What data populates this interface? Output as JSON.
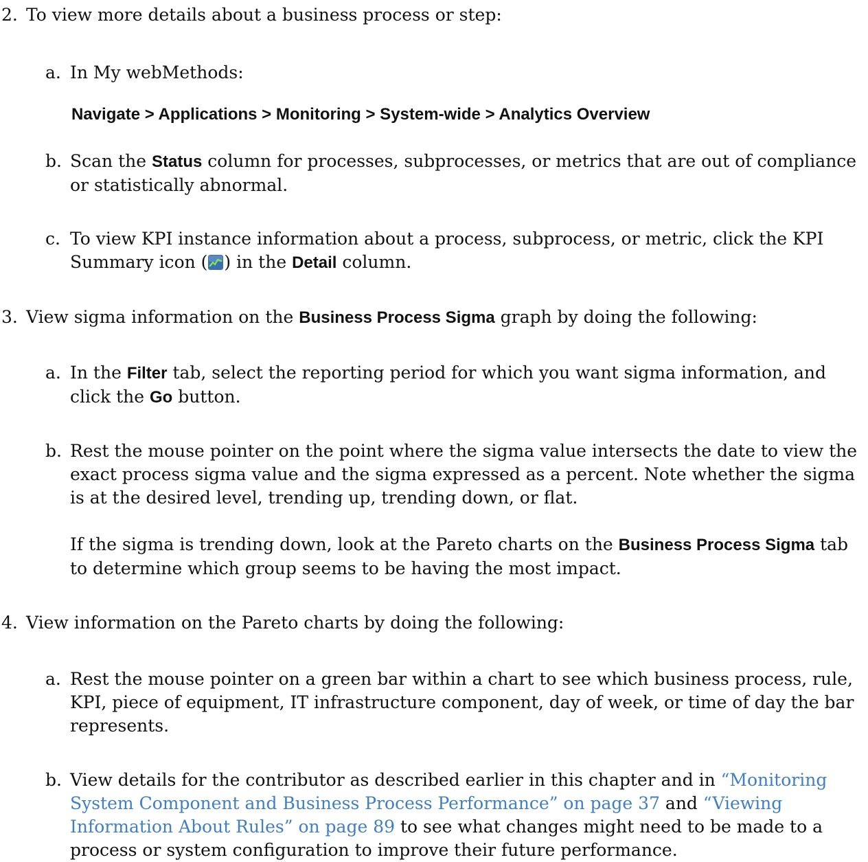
{
  "step2": {
    "num": "2.",
    "text": "To view more details about a business process or step:",
    "a": {
      "letter": "a.",
      "text": "In My webMethods:",
      "nav": "Navigate > Applications > Monitoring > System-wide > Analytics Overview"
    },
    "b": {
      "letter": "b.",
      "t1": "Scan the ",
      "bold": "Status",
      "t2": " column for processes, subprocesses, or metrics that are out of compliance or statistically abnormal."
    },
    "c": {
      "letter": "c.",
      "t1": "To view KPI instance information about a process, subprocess, or metric, click the KPI Summary icon (",
      "t2": ") in the ",
      "bold": "Detail",
      "t3": " column.",
      "icon": "kpi-summary-icon"
    }
  },
  "step3": {
    "num": "3.",
    "t1": "View sigma information on the ",
    "bold": "Business Process Sigma",
    "t2": " graph by doing the following:",
    "a": {
      "letter": "a.",
      "t1": "In the ",
      "bold1": "Filter",
      "t2": " tab, select the reporting period for which you want sigma information, and click the ",
      "bold2": "Go",
      "t3": " button."
    },
    "b": {
      "letter": "b.",
      "text": "Rest the mouse pointer on the point where the sigma value intersects the date to view the exact process sigma value and the sigma expressed as a percent. Note whether the sigma is at the desired level, trending up, trending down, or flat.",
      "p2_t1": "If the sigma is trending down, look at the Pareto charts on the ",
      "p2_bold": "Business Process Sigma",
      "p2_t2": " tab to determine which group seems to be having the most impact."
    }
  },
  "step4": {
    "num": "4.",
    "text": "View information on the Pareto charts by doing the following:",
    "a": {
      "letter": "a.",
      "text": "Rest the mouse pointer on a green bar within a chart to see which business process, rule, KPI, piece of equipment, IT infrastructure component, day of week, or time of day the bar represents."
    },
    "b": {
      "letter": "b.",
      "t1": "View details for the contributor as described earlier in this chapter and in ",
      "link1": "“Monitoring System Component and Business Process Performance” on page 37",
      "t2": " and ",
      "link2": "“Viewing Information About Rules” on page 89",
      "t3": " to see what changes might need to be made to a process or system configuration to improve their future performance."
    }
  },
  "colors": {
    "text": "#111111",
    "link": "#3f7fc2",
    "icon_bg": "#3b6fb0",
    "icon_line": "#7fe05a"
  }
}
